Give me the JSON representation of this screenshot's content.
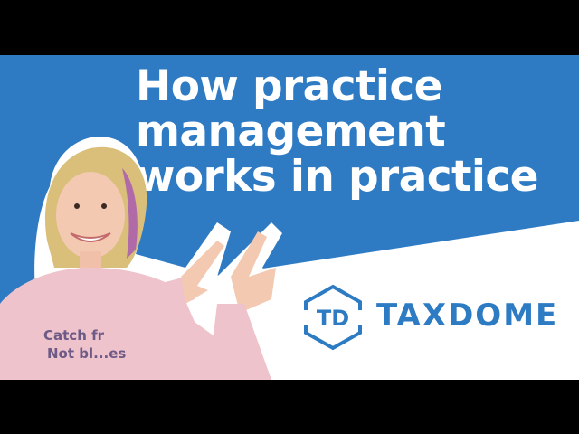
{
  "headline": {
    "line1": "How practice",
    "line2": "management",
    "line3": "works in practice"
  },
  "brand": {
    "monogram": "TD",
    "name": "TAXDOME"
  },
  "shirt_text": [
    "Catch fr",
    "Not bl...es"
  ],
  "colors": {
    "accent_blue": "#2e7bc4",
    "logo_blue": "#2d7bc3",
    "sweater_pink": "#eec3cc",
    "background": "#ffffff",
    "letterbox": "#000000"
  },
  "icons": [
    "hexagon-logo-icon"
  ]
}
